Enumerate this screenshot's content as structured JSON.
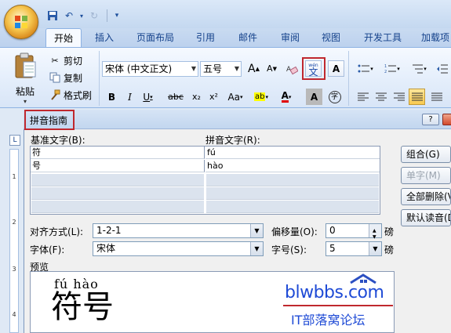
{
  "quick_access": {
    "save_icon": "floppy-icon",
    "undo_icon": "undo-icon",
    "redo_icon": "redo-icon",
    "customize_icon": "chevron-down-icon"
  },
  "tabs": [
    "开始",
    "插入",
    "页面布局",
    "引用",
    "邮件",
    "审阅",
    "视图",
    "开发工具",
    "加载项"
  ],
  "clipboard": {
    "paste": "粘贴",
    "cut": "剪切",
    "copy": "复制",
    "format_painter": "格式刷"
  },
  "font": {
    "name": "宋体 (中文正文)",
    "size": "五号",
    "bold": "B",
    "italic": "I",
    "underline": "U",
    "strike": "abc",
    "subscript": "x₂",
    "superscript": "x²",
    "change_case": "Aa",
    "char_shading": "A",
    "enclose": "字",
    "phonetic": "wén",
    "phonetic_char": "文",
    "border_char": "A",
    "grow": "A",
    "shrink": "A"
  },
  "dialog": {
    "title": "拼音指南",
    "help": "?",
    "base_label": "基准文字(B):",
    "ruby_label": "拼音文字(R):",
    "rows": [
      {
        "base": "符",
        "ruby": "fú"
      },
      {
        "base": "号",
        "ruby": "hào"
      }
    ],
    "buttons": {
      "group": "组合(G)",
      "mono": "单字(M)",
      "clear": "全部删除(V)",
      "default": "默认读音(D)"
    },
    "align_label": "对齐方式(L):",
    "align_value": "1-2-1",
    "offset_label": "偏移量(O):",
    "offset_value": "0",
    "offset_unit": "磅",
    "font_label": "字体(F):",
    "font_value": "宋体",
    "size_label": "字号(S):",
    "size_value": "5",
    "size_unit": "磅",
    "preview_label": "预览",
    "preview_ruby": "fú hào",
    "preview_text": "符号"
  },
  "watermark": {
    "site": "blwbbs.com",
    "caption": "IT部落窝论坛"
  },
  "ruler": [
    "1",
    "2",
    "3",
    "4"
  ],
  "colors": {
    "accent": "#15428b",
    "highlight_red": "#c0282e"
  }
}
